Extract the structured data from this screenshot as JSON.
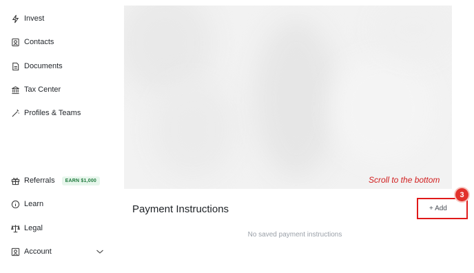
{
  "sidebar": {
    "items": [
      {
        "label": "Invest",
        "icon": "lightning-icon"
      },
      {
        "label": "Contacts",
        "icon": "contact-card-icon"
      },
      {
        "label": "Documents",
        "icon": "document-icon"
      },
      {
        "label": "Tax Center",
        "icon": "bank-icon"
      },
      {
        "label": "Profiles & Teams",
        "icon": "magic-wand-icon"
      }
    ],
    "bottom_items": [
      {
        "label": "Referrals",
        "icon": "gift-icon",
        "badge": "EARN $1,000"
      },
      {
        "label": "Learn",
        "icon": "info-icon"
      },
      {
        "label": "Legal",
        "icon": "scale-icon"
      },
      {
        "label": "Account",
        "icon": "user-icon"
      }
    ]
  },
  "annotation": {
    "text": "Scroll to the bottom",
    "step": "3"
  },
  "payment": {
    "title": "Payment Instructions",
    "add_label": "+ Add",
    "empty_text": "No saved payment instructions"
  }
}
